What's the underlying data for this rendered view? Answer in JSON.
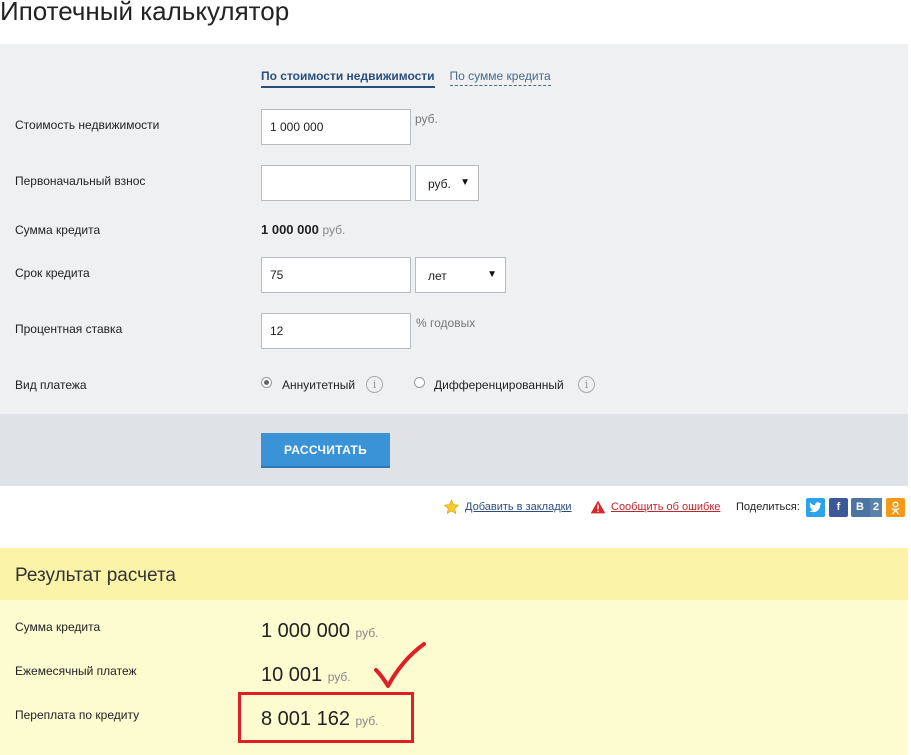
{
  "page": {
    "title": "Ипотечный калькулятор"
  },
  "tabs": {
    "active": "По стоимости недвижимости",
    "inactive": "По сумме кредита"
  },
  "form": {
    "property_cost": {
      "label": "Стоимость недвижимости",
      "value": "1 000 000",
      "unit": "руб."
    },
    "down_payment": {
      "label": "Первоначальный взнос",
      "value": "",
      "unit_select": "руб."
    },
    "loan_sum": {
      "label": "Сумма кредита",
      "value": "1 000 000",
      "unit": "руб."
    },
    "loan_term": {
      "label": "Срок кредита",
      "value": "75",
      "unit_select": "лет"
    },
    "interest_rate": {
      "label": "Процентная ставка",
      "value": "12",
      "unit": "% годовых"
    },
    "payment_type": {
      "label": "Вид платежа",
      "options": [
        {
          "label": "Аннуитетный",
          "selected": true
        },
        {
          "label": "Дифференцированный",
          "selected": false
        }
      ]
    },
    "calculate_label": "РАССЧИТАТЬ"
  },
  "utility": {
    "bookmark_label": "Добавить в закладки",
    "report_label": "Сообщить об ошибке",
    "share_label": "Поделиться:",
    "vk_count": "2"
  },
  "result": {
    "title": "Результат расчета",
    "rows": [
      {
        "label": "Сумма кредита",
        "value": "1 000 000",
        "unit": "руб."
      },
      {
        "label": "Ежемесячный платеж",
        "value": "10 001",
        "unit": "руб."
      },
      {
        "label": "Переплата по кредиту",
        "value": "8 001 162",
        "unit": "руб."
      }
    ]
  },
  "colors": {
    "panel_bg": "#eef0f2",
    "button_blue": "#3a93d6",
    "result_header": "#fbf3a8",
    "result_body": "#fdfbd0",
    "annotation_red": "#e01e25"
  },
  "icons": {
    "bookmark": "star-icon",
    "report": "warning-icon",
    "twitter": "twitter-icon",
    "facebook": "facebook-icon",
    "vk": "vk-icon",
    "odnoklassniki": "odnoklassniki-icon",
    "annotation": "checkmark-icon"
  }
}
